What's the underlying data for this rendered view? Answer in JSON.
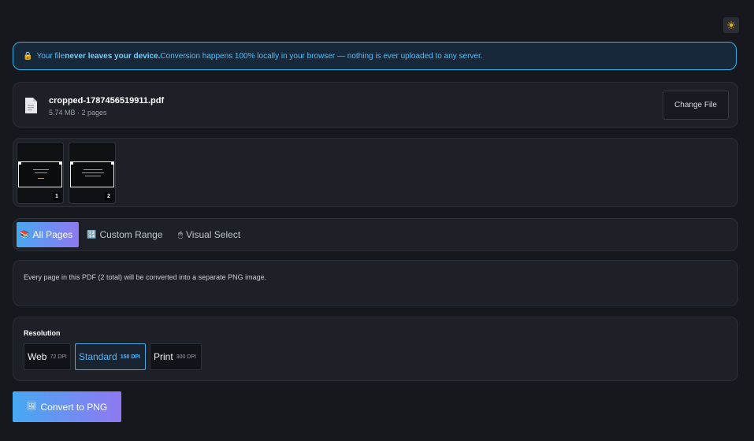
{
  "header": {
    "theme_icon": "sun-icon",
    "theme_glyph": "☀"
  },
  "notice": {
    "prefix": "Your file ",
    "bold": "never leaves your device.",
    "suffix": " Conversion happens 100% locally in your browser — nothing is ever uploaded to any server.",
    "icon": "lock-icon"
  },
  "file": {
    "name": "cropped-1787456519911.pdf",
    "meta": "5.74 MB · 2 pages",
    "change_label": "Change File"
  },
  "thumbnails": [
    {
      "number": "1"
    },
    {
      "number": "2"
    }
  ],
  "modes": {
    "all": {
      "label": "All Pages",
      "icon": "📚"
    },
    "range": {
      "label": "Custom Range",
      "icon": "🔢"
    },
    "visual": {
      "label": "Visual Select",
      "icon": "🖱"
    }
  },
  "description": "Every page in this PDF (2 total) will be converted into a separate PNG image.",
  "resolution": {
    "title": "Resolution",
    "options": [
      {
        "label": "Web",
        "dpi": "72 DPI"
      },
      {
        "label": "Standard",
        "dpi": "150 DPI"
      },
      {
        "label": "Print",
        "dpi": "300 DPI"
      }
    ],
    "selected": "Standard"
  },
  "convert": {
    "label": "Convert to PNG",
    "icon": "🖼"
  },
  "colors": {
    "accent": "#4ea6f3",
    "accent_end": "#8f78f1",
    "background": "#16181d",
    "notice_border": "#38b2e8"
  }
}
